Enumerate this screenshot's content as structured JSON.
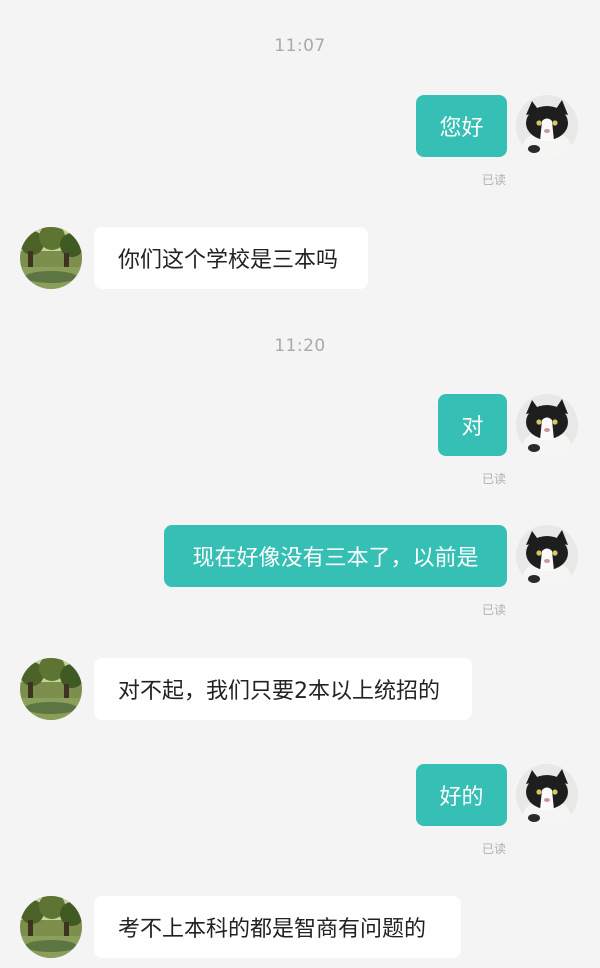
{
  "chat": {
    "timestamps": [
      "11:07",
      "11:20"
    ],
    "read_receipt": "已读",
    "messages": [
      {
        "direction": "out",
        "text": "您好",
        "read": true
      },
      {
        "direction": "in",
        "text": "你们这个学校是三本吗"
      },
      {
        "direction": "out",
        "text": "对",
        "read": true
      },
      {
        "direction": "out",
        "text": "现在好像没有三本了，以前是",
        "read": true
      },
      {
        "direction": "in",
        "text": "对不起，我们只要2本以上统招的"
      },
      {
        "direction": "out",
        "text": "好的",
        "read": true
      },
      {
        "direction": "in",
        "text": "考不上本科的都是智商有问题的"
      }
    ]
  },
  "avatars": {
    "self": "cat-avatar-icon",
    "other": "tree-landscape-avatar-icon"
  },
  "colors": {
    "outgoing_bubble": "#36bfb5",
    "incoming_bubble": "#ffffff",
    "background": "#f4f4f4"
  }
}
